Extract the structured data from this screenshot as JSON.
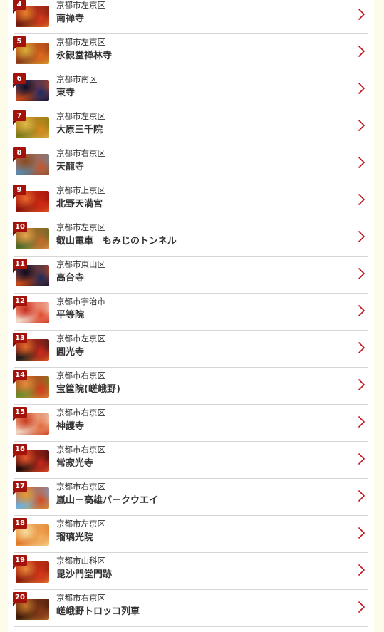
{
  "list": {
    "items": [
      {
        "rank": "4",
        "area": "京都市左京区",
        "name": "南禅寺",
        "colors": [
          "#d63a1c",
          "#6b1a10",
          "#e9842a"
        ]
      },
      {
        "rank": "5",
        "area": "京都市左京区",
        "name": "永観堂禅林寺",
        "colors": [
          "#e26a1c",
          "#8a3a1a",
          "#d9b13a"
        ]
      },
      {
        "rank": "6",
        "area": "京都市南区",
        "name": "東寺",
        "colors": [
          "#1a2a6a",
          "#c94a1a",
          "#0a0e28"
        ]
      },
      {
        "rank": "7",
        "area": "京都市左京区",
        "name": "大原三千院",
        "colors": [
          "#d88a1c",
          "#7a7a1a",
          "#e2b84a"
        ]
      },
      {
        "rank": "8",
        "area": "京都市右京区",
        "name": "天龍寺",
        "colors": [
          "#c8562a",
          "#5a8ab0",
          "#8a4a1a"
        ]
      },
      {
        "rank": "9",
        "area": "京都市上京区",
        "name": "北野天満宮",
        "colors": [
          "#d42a14",
          "#8a120c",
          "#e86a2a"
        ]
      },
      {
        "rank": "10",
        "area": "京都市左京区",
        "name": "叡山電車　もみじのトンネル",
        "colors": [
          "#c96a2a",
          "#4a6a2a",
          "#e9a24a"
        ]
      },
      {
        "rank": "11",
        "area": "京都市東山区",
        "name": "高台寺",
        "colors": [
          "#1a2a5a",
          "#c84a1a",
          "#0a0a20"
        ]
      },
      {
        "rank": "12",
        "area": "京都市宇治市",
        "name": "平等院",
        "colors": [
          "#e24a2a",
          "#f2e2d2",
          "#c8281a"
        ]
      },
      {
        "rank": "13",
        "area": "京都市左京区",
        "name": "圓光寺",
        "colors": [
          "#d8281a",
          "#1a1a1a",
          "#e96a2a"
        ]
      },
      {
        "rank": "14",
        "area": "京都市右京区",
        "name": "宝筐院(嵯峨野)",
        "colors": [
          "#d8381a",
          "#6a8a2a",
          "#e88a3a"
        ]
      },
      {
        "rank": "15",
        "area": "京都市右京区",
        "name": "神護寺",
        "colors": [
          "#e26a3a",
          "#f0d8c8",
          "#c8381a"
        ]
      },
      {
        "rank": "16",
        "area": "京都市右京区",
        "name": "常寂光寺",
        "colors": [
          "#c8281a",
          "#1a0a0a",
          "#e8582a"
        ]
      },
      {
        "rank": "17",
        "area": "京都市右京区",
        "name": "嵐山－高雄パークウエイ",
        "colors": [
          "#d84a1a",
          "#6ab0e0",
          "#e89a2a"
        ]
      },
      {
        "rank": "18",
        "area": "京都市左京区",
        "name": "瑠璃光院",
        "colors": [
          "#f0b060",
          "#e27a2a",
          "#f8e0a0"
        ]
      },
      {
        "rank": "19",
        "area": "京都市山科区",
        "name": "毘沙門堂門跡",
        "colors": [
          "#d8381a",
          "#8a1a0a",
          "#e88a3a"
        ]
      },
      {
        "rank": "20",
        "area": "京都市右京区",
        "name": "嵯峨野トロッコ列車",
        "colors": [
          "#8a3a1a",
          "#3a1a0a",
          "#c8782a"
        ]
      }
    ]
  },
  "icons": {
    "chevron": "chevron-right-icon"
  },
  "accent": {
    "rank_badge": "#a4120c",
    "chevron": "#c0121a"
  }
}
